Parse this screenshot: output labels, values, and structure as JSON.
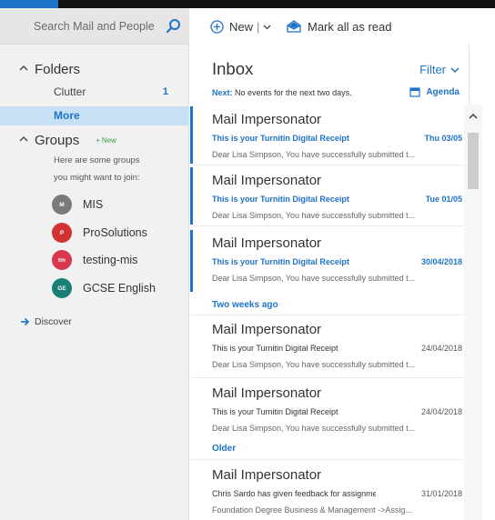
{
  "search": {
    "placeholder": "Search Mail and People",
    "icon": "search-icon"
  },
  "toolbar": {
    "new_label": "New",
    "separator": "|",
    "mark_all_label": "Mark all as read"
  },
  "nav": {
    "folders_label": "Folders",
    "items": [
      {
        "label": "Clutter",
        "count": "1"
      },
      {
        "label": "More",
        "count": ""
      }
    ],
    "groups_label": "Groups",
    "new_badge": "New",
    "groups_hint_line1": "Here are some groups",
    "groups_hint_line2": "you might want to join:",
    "groups": [
      {
        "initials": "M",
        "name": "MIS",
        "color": "#7a7a7a"
      },
      {
        "initials": "P",
        "name": "ProSolutions",
        "color": "#d23232"
      },
      {
        "initials": "tm",
        "name": "testing-mis",
        "color": "#d9364f"
      },
      {
        "initials": "GE",
        "name": "GCSE English",
        "color": "#1a7f77"
      }
    ],
    "discover_label": "Discover"
  },
  "inbox": {
    "title": "Inbox",
    "filter_label": "Filter",
    "next_label": "Next:",
    "next_text": "No events for the next two days.",
    "agenda_label": "Agenda",
    "section_two_weeks": "Two weeks ago",
    "section_older": "Older",
    "messages": [
      {
        "sender": "Mail Impersonator",
        "subject": "This is your Turnitin Digital Receipt",
        "date": "Thu 03/05",
        "preview": "Dear Lisa Simpson, You have successfully submitted t...",
        "unread": true
      },
      {
        "sender": "Mail Impersonator",
        "subject": "This is your Turnitin Digital Receipt",
        "date": "Tue 01/05",
        "preview": "Dear Lisa Simpson, You have successfully submitted t...",
        "unread": true
      },
      {
        "sender": "Mail Impersonator",
        "subject": "This is your Turnitin Digital Receipt",
        "date": "30/04/2018",
        "preview": "Dear Lisa Simpson, You have successfully submitted t...",
        "unread": true
      },
      {
        "sender": "Mail Impersonator",
        "subject": "This is your Turnitin Digital Receipt",
        "date": "24/04/2018",
        "preview": "Dear Lisa Simpson, You have successfully submitted t...",
        "unread": false
      },
      {
        "sender": "Mail Impersonator",
        "subject": "This is your Turnitin Digital Receipt",
        "date": "24/04/2018",
        "preview": "Dear Lisa Simpson, You have successfully submitted t...",
        "unread": false
      },
      {
        "sender": "Mail Impersonator",
        "subject": "Chris Sardo has given feedback for assignmei",
        "date": "31/01/2018",
        "preview": "Foundation Degree Business & Management ->Assig...",
        "unread": false
      }
    ]
  },
  "colors": {
    "accent": "#1e73c8",
    "selected_bg": "#c8e0f5",
    "new_badge": "#3aa04a",
    "topbar": "#111111"
  }
}
